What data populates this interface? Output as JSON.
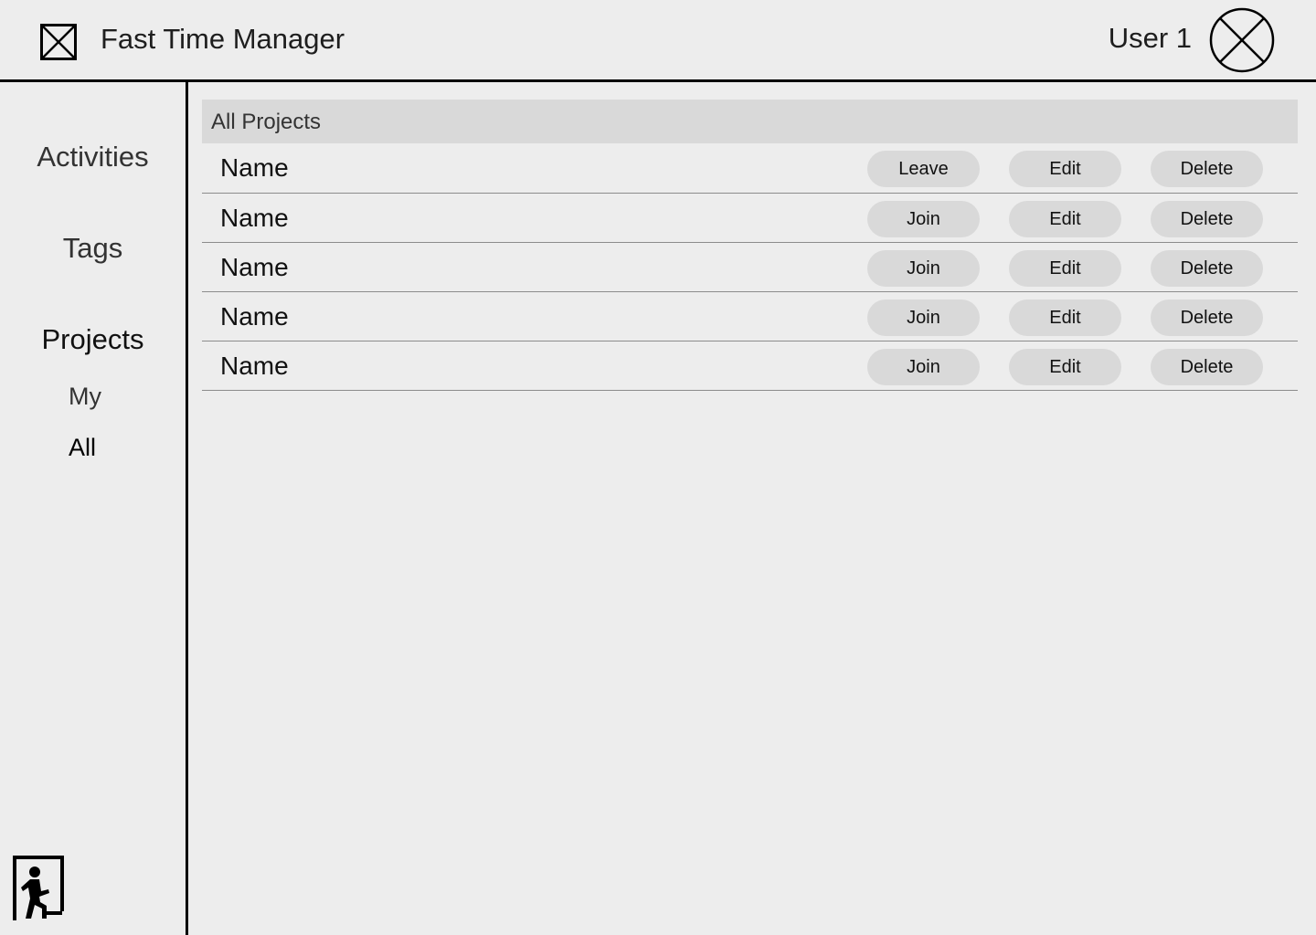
{
  "header": {
    "app_title": "Fast Time Manager",
    "user_name": "User 1",
    "logo_icon": "image-placeholder-icon",
    "avatar_icon": "avatar-placeholder-icon"
  },
  "sidebar": {
    "items": [
      {
        "label": "Activities"
      },
      {
        "label": "Tags"
      },
      {
        "label": "Projects",
        "children": [
          {
            "label": "My"
          },
          {
            "label": "All",
            "selected": true
          }
        ]
      }
    ],
    "logout_icon": "exit-door-icon"
  },
  "main": {
    "section_title": "All Projects",
    "projects": [
      {
        "name": "Name",
        "membership_label": "Leave",
        "edit_label": "Edit",
        "delete_label": "Delete"
      },
      {
        "name": "Name",
        "membership_label": "Join",
        "edit_label": "Edit",
        "delete_label": "Delete"
      },
      {
        "name": "Name",
        "membership_label": "Join",
        "edit_label": "Edit",
        "delete_label": "Delete"
      },
      {
        "name": "Name",
        "membership_label": "Join",
        "edit_label": "Edit",
        "delete_label": "Delete"
      },
      {
        "name": "Name",
        "membership_label": "Join",
        "edit_label": "Edit",
        "delete_label": "Delete"
      }
    ]
  },
  "colors": {
    "background": "#ededed",
    "section_header": "#d9d9d9",
    "button": "#d9d9d9",
    "divider": "#000000"
  }
}
